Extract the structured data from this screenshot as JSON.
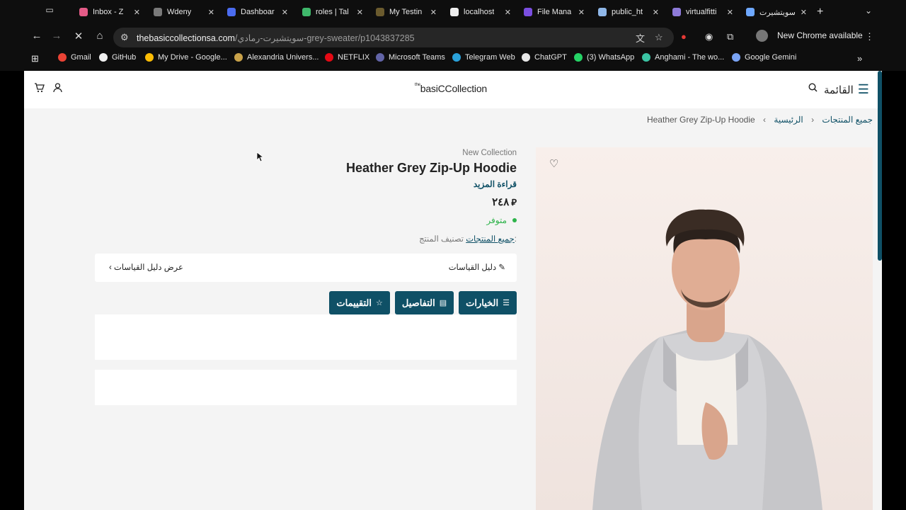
{
  "browser": {
    "tabs": [
      {
        "label": "Inbox - Z",
        "icon": "mail-icon",
        "color": "#e45b87"
      },
      {
        "label": "Wdeny",
        "icon": "bot-icon",
        "color": "#7a7a7a"
      },
      {
        "label": "Dashboar",
        "icon": "play-icon",
        "color": "#4b6cf0"
      },
      {
        "label": "roles | Tal",
        "icon": "bolt-icon",
        "color": "#3fb86b"
      },
      {
        "label": "My Testin",
        "icon": "p-icon",
        "color": "#6b5b2e"
      },
      {
        "label": "localhost",
        "icon": "triangle-icon",
        "color": "#eeeeee"
      },
      {
        "label": "File Mana",
        "icon": "h-icon",
        "color": "#7a4ee0"
      },
      {
        "label": "public_ht",
        "icon": "globe-icon",
        "color": "#8fb7e8"
      },
      {
        "label": "virtualfitti",
        "icon": "logo-icon",
        "color": "#8d7ad8"
      },
      {
        "label": "سويتشيرت",
        "icon": "loading-icon",
        "color": "#6ea8ff"
      }
    ],
    "url_host": "thebasiccollectionsa.com",
    "url_path": "/سويتشيرت-رمادي-grey-sweater/p1043837285",
    "new_chrome": "New Chrome available",
    "bookmarks": [
      {
        "label": "Gmail",
        "color": "#ea4335"
      },
      {
        "label": "GitHub",
        "color": "#f0f0f0"
      },
      {
        "label": "My Drive - Google...",
        "color": "#fbbc04"
      },
      {
        "label": "Alexandria Univers...",
        "color": "#c9a24a"
      },
      {
        "label": "NETFLIX",
        "color": "#e50914"
      },
      {
        "label": "Microsoft Teams",
        "color": "#6264a7"
      },
      {
        "label": "Telegram Web",
        "color": "#2aa1da"
      },
      {
        "label": "ChatGPT",
        "color": "#e8e8e8"
      },
      {
        "label": "(3) WhatsApp",
        "color": "#25d366"
      },
      {
        "label": "Anghami - The wo...",
        "color": "#3bc4a4"
      },
      {
        "label": "Google Gemini",
        "color": "#7aa4f5"
      }
    ]
  },
  "site": {
    "logo_prefix": "the",
    "logo": "basiCCollection",
    "menu_label": "القائمة",
    "breadcrumb": {
      "product": "Heather Grey Zip-Up Hoodie",
      "all": "جميع المنتجات",
      "home": "الرئيسية"
    },
    "product": {
      "badge": "New Collection",
      "title": "Heather Grey Zip-Up Hoodie",
      "read_more": "قراءة المزيد",
      "price": "٢٤٨",
      "stock": "متوفر",
      "category_label": "تصنيف المنتج:",
      "category_value": "جميع المنتجات"
    },
    "size_guide": {
      "title": "دليل القياسات",
      "action": "عرض دليل القياسات"
    },
    "tabs": {
      "options": "الخيارات",
      "details": "التفاصيل",
      "reviews": "التقييمات"
    },
    "accent": "#0f5066"
  }
}
